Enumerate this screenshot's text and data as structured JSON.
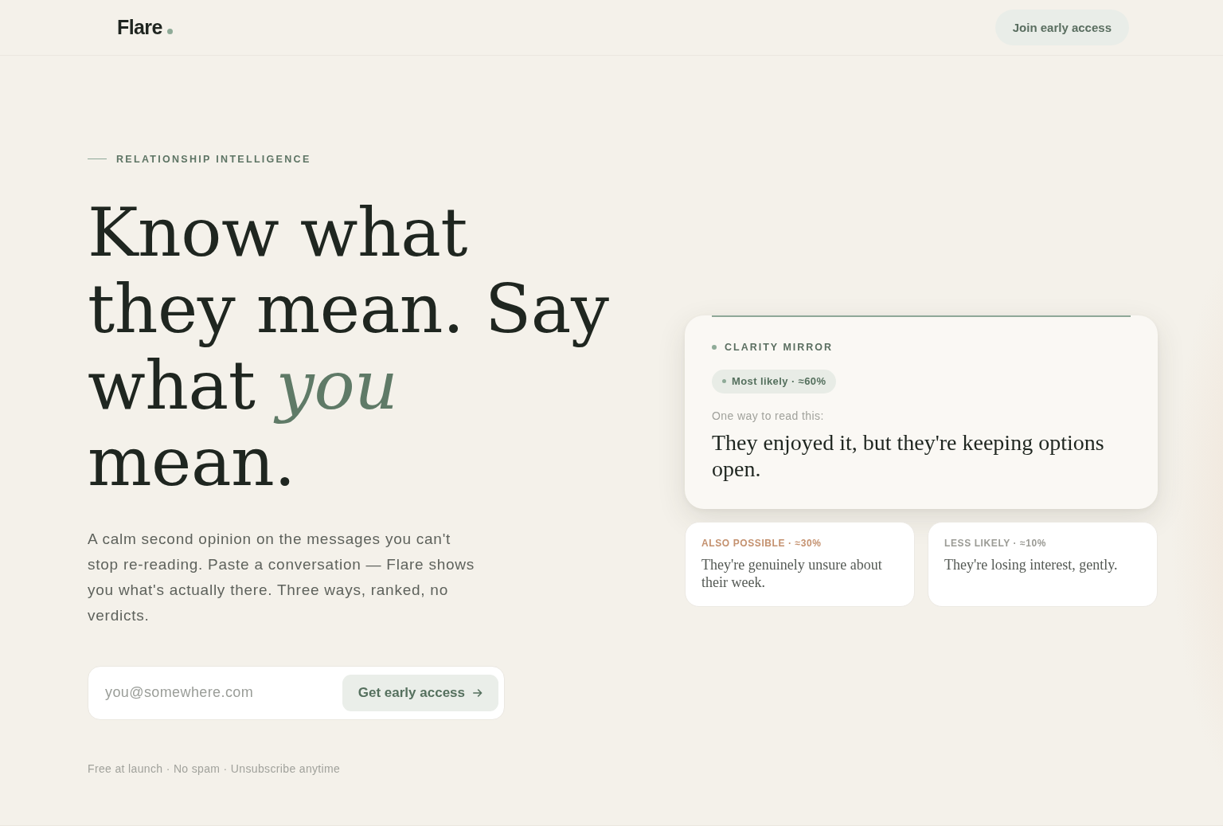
{
  "header": {
    "logo": "Flare",
    "cta": "Join early access"
  },
  "hero": {
    "eyebrow": "RELATIONSHIP INTELLIGENCE",
    "headline": "Know what they mean. Say what *you* mean.",
    "intro": "A calm second opinion on the messages you can't stop re-reading. Paste a conversation — Flare shows you what's actually there. Three ways, ranked, no verdicts.",
    "signup": {
      "placeholder": "you@somewhere.com",
      "button": "Get early access"
    },
    "note": "Free at launch · No spam · Unsubscribe anytime"
  },
  "mirror": {
    "eyebrow": "CLARITY MIRROR",
    "top": {
      "badge": "Most likely · ≈60%",
      "lead": "One way to read this:",
      "reading": "They enjoyed it, but they're keeping options open."
    },
    "alternatives": [
      {
        "label": "ALSO POSSIBLE · ≈30%",
        "color": "#c4916f",
        "reading": "They're genuinely unsure about their week."
      },
      {
        "label": "LESS LIKELY · ≈10%",
        "color": "#9b9b95",
        "reading": "They're losing interest, gently."
      }
    ]
  }
}
